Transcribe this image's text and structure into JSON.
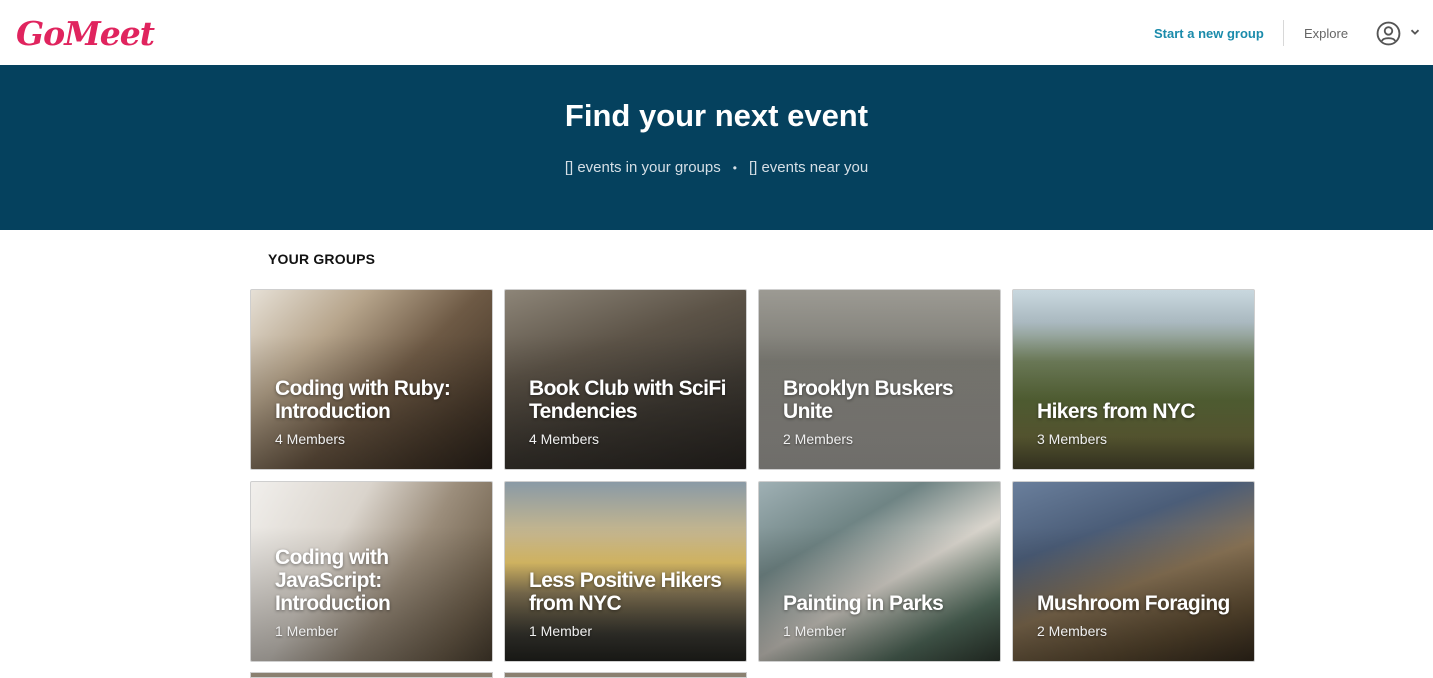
{
  "header": {
    "logo": "GoMeet",
    "start_group": "Start a new group",
    "explore": "Explore"
  },
  "hero": {
    "title": "Find your next event",
    "groups_events": "[] events in your groups",
    "separator": "•",
    "near_events": "[] events near you",
    "background": "#05415e"
  },
  "section_title": "YOUR GROUPS",
  "groups": [
    {
      "name": "Coding with Ruby: Introduction",
      "members": "4 Members"
    },
    {
      "name": "Book Club with SciFi Tendencies",
      "members": "4 Members"
    },
    {
      "name": "Brooklyn Buskers Unite",
      "members": "2 Members"
    },
    {
      "name": "Hikers from NYC",
      "members": "3 Members"
    },
    {
      "name": "Coding with JavaScript: Introduction",
      "members": "1 Member"
    },
    {
      "name": "Less Positive Hikers from NYC",
      "members": "1 Member"
    },
    {
      "name": "Painting in Parks",
      "members": "1 Member"
    },
    {
      "name": "Mushroom Foraging",
      "members": "2 Members"
    }
  ],
  "colors": {
    "brand": "#e0245e",
    "link": "#1a8bab"
  }
}
